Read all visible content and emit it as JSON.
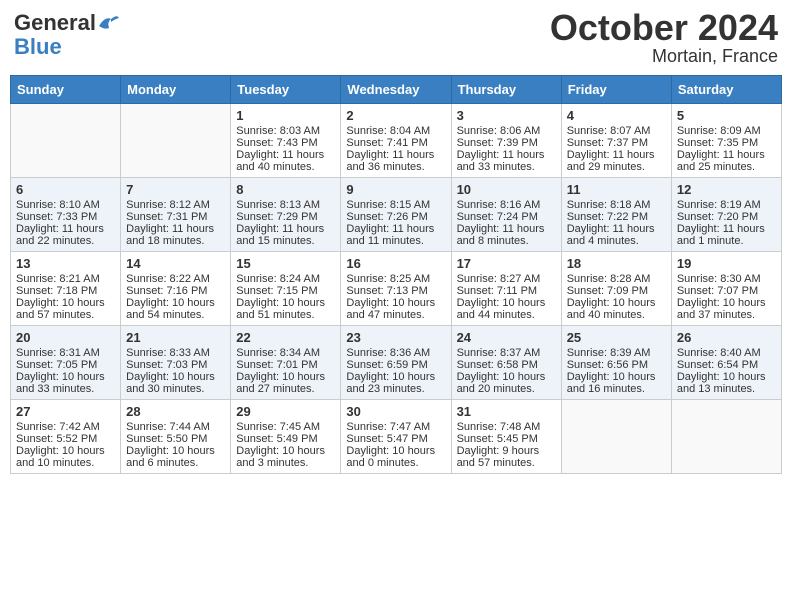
{
  "header": {
    "logo_general": "General",
    "logo_blue": "Blue",
    "month": "October 2024",
    "location": "Mortain, France"
  },
  "days_of_week": [
    "Sunday",
    "Monday",
    "Tuesday",
    "Wednesday",
    "Thursday",
    "Friday",
    "Saturday"
  ],
  "weeks": [
    [
      {
        "day": "",
        "sunrise": "",
        "sunset": "",
        "daylight": ""
      },
      {
        "day": "",
        "sunrise": "",
        "sunset": "",
        "daylight": ""
      },
      {
        "day": "1",
        "sunrise": "Sunrise: 8:03 AM",
        "sunset": "Sunset: 7:43 PM",
        "daylight": "Daylight: 11 hours and 40 minutes."
      },
      {
        "day": "2",
        "sunrise": "Sunrise: 8:04 AM",
        "sunset": "Sunset: 7:41 PM",
        "daylight": "Daylight: 11 hours and 36 minutes."
      },
      {
        "day": "3",
        "sunrise": "Sunrise: 8:06 AM",
        "sunset": "Sunset: 7:39 PM",
        "daylight": "Daylight: 11 hours and 33 minutes."
      },
      {
        "day": "4",
        "sunrise": "Sunrise: 8:07 AM",
        "sunset": "Sunset: 7:37 PM",
        "daylight": "Daylight: 11 hours and 29 minutes."
      },
      {
        "day": "5",
        "sunrise": "Sunrise: 8:09 AM",
        "sunset": "Sunset: 7:35 PM",
        "daylight": "Daylight: 11 hours and 25 minutes."
      }
    ],
    [
      {
        "day": "6",
        "sunrise": "Sunrise: 8:10 AM",
        "sunset": "Sunset: 7:33 PM",
        "daylight": "Daylight: 11 hours and 22 minutes."
      },
      {
        "day": "7",
        "sunrise": "Sunrise: 8:12 AM",
        "sunset": "Sunset: 7:31 PM",
        "daylight": "Daylight: 11 hours and 18 minutes."
      },
      {
        "day": "8",
        "sunrise": "Sunrise: 8:13 AM",
        "sunset": "Sunset: 7:29 PM",
        "daylight": "Daylight: 11 hours and 15 minutes."
      },
      {
        "day": "9",
        "sunrise": "Sunrise: 8:15 AM",
        "sunset": "Sunset: 7:26 PM",
        "daylight": "Daylight: 11 hours and 11 minutes."
      },
      {
        "day": "10",
        "sunrise": "Sunrise: 8:16 AM",
        "sunset": "Sunset: 7:24 PM",
        "daylight": "Daylight: 11 hours and 8 minutes."
      },
      {
        "day": "11",
        "sunrise": "Sunrise: 8:18 AM",
        "sunset": "Sunset: 7:22 PM",
        "daylight": "Daylight: 11 hours and 4 minutes."
      },
      {
        "day": "12",
        "sunrise": "Sunrise: 8:19 AM",
        "sunset": "Sunset: 7:20 PM",
        "daylight": "Daylight: 11 hours and 1 minute."
      }
    ],
    [
      {
        "day": "13",
        "sunrise": "Sunrise: 8:21 AM",
        "sunset": "Sunset: 7:18 PM",
        "daylight": "Daylight: 10 hours and 57 minutes."
      },
      {
        "day": "14",
        "sunrise": "Sunrise: 8:22 AM",
        "sunset": "Sunset: 7:16 PM",
        "daylight": "Daylight: 10 hours and 54 minutes."
      },
      {
        "day": "15",
        "sunrise": "Sunrise: 8:24 AM",
        "sunset": "Sunset: 7:15 PM",
        "daylight": "Daylight: 10 hours and 51 minutes."
      },
      {
        "day": "16",
        "sunrise": "Sunrise: 8:25 AM",
        "sunset": "Sunset: 7:13 PM",
        "daylight": "Daylight: 10 hours and 47 minutes."
      },
      {
        "day": "17",
        "sunrise": "Sunrise: 8:27 AM",
        "sunset": "Sunset: 7:11 PM",
        "daylight": "Daylight: 10 hours and 44 minutes."
      },
      {
        "day": "18",
        "sunrise": "Sunrise: 8:28 AM",
        "sunset": "Sunset: 7:09 PM",
        "daylight": "Daylight: 10 hours and 40 minutes."
      },
      {
        "day": "19",
        "sunrise": "Sunrise: 8:30 AM",
        "sunset": "Sunset: 7:07 PM",
        "daylight": "Daylight: 10 hours and 37 minutes."
      }
    ],
    [
      {
        "day": "20",
        "sunrise": "Sunrise: 8:31 AM",
        "sunset": "Sunset: 7:05 PM",
        "daylight": "Daylight: 10 hours and 33 minutes."
      },
      {
        "day": "21",
        "sunrise": "Sunrise: 8:33 AM",
        "sunset": "Sunset: 7:03 PM",
        "daylight": "Daylight: 10 hours and 30 minutes."
      },
      {
        "day": "22",
        "sunrise": "Sunrise: 8:34 AM",
        "sunset": "Sunset: 7:01 PM",
        "daylight": "Daylight: 10 hours and 27 minutes."
      },
      {
        "day": "23",
        "sunrise": "Sunrise: 8:36 AM",
        "sunset": "Sunset: 6:59 PM",
        "daylight": "Daylight: 10 hours and 23 minutes."
      },
      {
        "day": "24",
        "sunrise": "Sunrise: 8:37 AM",
        "sunset": "Sunset: 6:58 PM",
        "daylight": "Daylight: 10 hours and 20 minutes."
      },
      {
        "day": "25",
        "sunrise": "Sunrise: 8:39 AM",
        "sunset": "Sunset: 6:56 PM",
        "daylight": "Daylight: 10 hours and 16 minutes."
      },
      {
        "day": "26",
        "sunrise": "Sunrise: 8:40 AM",
        "sunset": "Sunset: 6:54 PM",
        "daylight": "Daylight: 10 hours and 13 minutes."
      }
    ],
    [
      {
        "day": "27",
        "sunrise": "Sunrise: 7:42 AM",
        "sunset": "Sunset: 5:52 PM",
        "daylight": "Daylight: 10 hours and 10 minutes."
      },
      {
        "day": "28",
        "sunrise": "Sunrise: 7:44 AM",
        "sunset": "Sunset: 5:50 PM",
        "daylight": "Daylight: 10 hours and 6 minutes."
      },
      {
        "day": "29",
        "sunrise": "Sunrise: 7:45 AM",
        "sunset": "Sunset: 5:49 PM",
        "daylight": "Daylight: 10 hours and 3 minutes."
      },
      {
        "day": "30",
        "sunrise": "Sunrise: 7:47 AM",
        "sunset": "Sunset: 5:47 PM",
        "daylight": "Daylight: 10 hours and 0 minutes."
      },
      {
        "day": "31",
        "sunrise": "Sunrise: 7:48 AM",
        "sunset": "Sunset: 5:45 PM",
        "daylight": "Daylight: 9 hours and 57 minutes."
      },
      {
        "day": "",
        "sunrise": "",
        "sunset": "",
        "daylight": ""
      },
      {
        "day": "",
        "sunrise": "",
        "sunset": "",
        "daylight": ""
      }
    ]
  ]
}
